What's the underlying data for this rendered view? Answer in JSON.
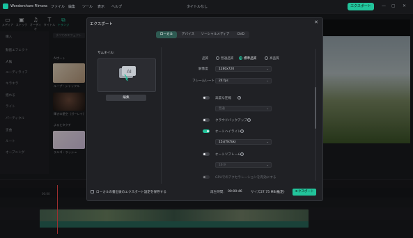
{
  "app": {
    "name": "Wondershare Filmora",
    "menus": [
      "ファイル",
      "編集",
      "ツール",
      "表示",
      "ヘルプ"
    ],
    "project_title": "タイトルなし",
    "export_button": "エクスポート",
    "window_controls": [
      "—",
      "▢",
      "✕"
    ]
  },
  "toolbar": {
    "items": [
      {
        "label": "メディア",
        "icon": "media-icon"
      },
      {
        "label": "ストック",
        "icon": "stock-icon"
      },
      {
        "label": "オーディオ",
        "icon": "audio-icon"
      },
      {
        "label": "タイトル",
        "icon": "title-icon"
      },
      {
        "label": "トランジ",
        "icon": "transition-icon"
      }
    ]
  },
  "left_nav": {
    "items": [
      "購入",
      "動画エフェクト",
      "人気",
      "ユーディライフ",
      "キラキラ",
      "揺れる",
      "ライト",
      "パーティクル",
      "歪曲",
      "ルート",
      "オーブニング"
    ],
    "selected_index": 2
  },
  "library": {
    "search_placeholder": "すべてのエフェクト",
    "section": "AIポート",
    "items": [
      "ループ・シャッフル",
      "輝きの星空（ガーレイ)",
      "よるとタクチ",
      "ラルゴ・ラッシュ"
    ]
  },
  "dialog": {
    "title": "エクスポート",
    "close": "✕",
    "tabs": [
      "ローカル",
      "デバイス",
      "ソーシャルメディア",
      "DVD"
    ],
    "selected_tab": 0,
    "thumbnail_label": "サムネイル:",
    "edit_button": "編集",
    "quality": {
      "label": "品質",
      "options": [
        "普通品質",
        "標準品質",
        "高品質"
      ],
      "selected": 1
    },
    "resolution": {
      "label": "解像度",
      "value": "1280x720"
    },
    "framerate": {
      "label": "フレームレート",
      "value": "24 fps"
    },
    "advanced_compression": {
      "label": "高度な圧縮",
      "on": false,
      "select": "普通"
    },
    "cloud_backup": {
      "label": "クラウドバックアップ",
      "on": false
    },
    "auto_highlight": {
      "label": "オートハイライト",
      "on": true,
      "select": "15s(TikTok)"
    },
    "auto_reframe": {
      "label": "オートリフレーム",
      "on": false,
      "select": "16:9"
    },
    "gpu_acceleration": {
      "label": "GPUでのアクセラレーションを有効にする"
    },
    "remember_settings": "ローカルの書出後のエクスポート設定を保存する",
    "duration_label": "再生時間：",
    "duration_value": "00:00:46",
    "size_label": "サイズ：",
    "size_value": "27.75 MB(推定)",
    "export_button": "エクスポート"
  },
  "timeline": {
    "playhead_time": "00:00"
  }
}
